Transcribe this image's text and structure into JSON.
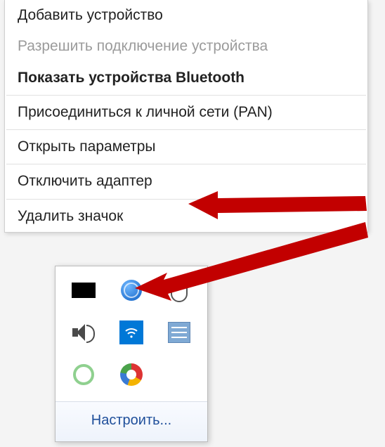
{
  "menu": {
    "items": [
      {
        "label": "Добавить устройство",
        "disabled": false,
        "bold": false
      },
      {
        "label": "Разрешить подключение устройства",
        "disabled": true,
        "bold": false
      },
      {
        "label": "Показать устройства Bluetooth",
        "disabled": false,
        "bold": true
      },
      {
        "sep": true
      },
      {
        "label": "Присоединиться к личной сети (PAN)",
        "disabled": false,
        "bold": false
      },
      {
        "sep": true
      },
      {
        "label": "Открыть параметры",
        "disabled": false,
        "bold": false
      },
      {
        "sep": true
      },
      {
        "label": "Отключить адаптер",
        "disabled": false,
        "bold": false
      },
      {
        "sep": true
      },
      {
        "label": "Удалить значок",
        "disabled": false,
        "bold": false
      }
    ]
  },
  "tray": {
    "icons": [
      {
        "name": "generic-black-icon"
      },
      {
        "name": "globe-icon"
      },
      {
        "name": "mouse-icon"
      },
      {
        "name": "speaker-icon"
      },
      {
        "name": "network-icon"
      },
      {
        "name": "book-icon"
      },
      {
        "name": "ring-icon"
      },
      {
        "name": "ccleaner-icon"
      }
    ],
    "footer_label": "Настроить..."
  }
}
